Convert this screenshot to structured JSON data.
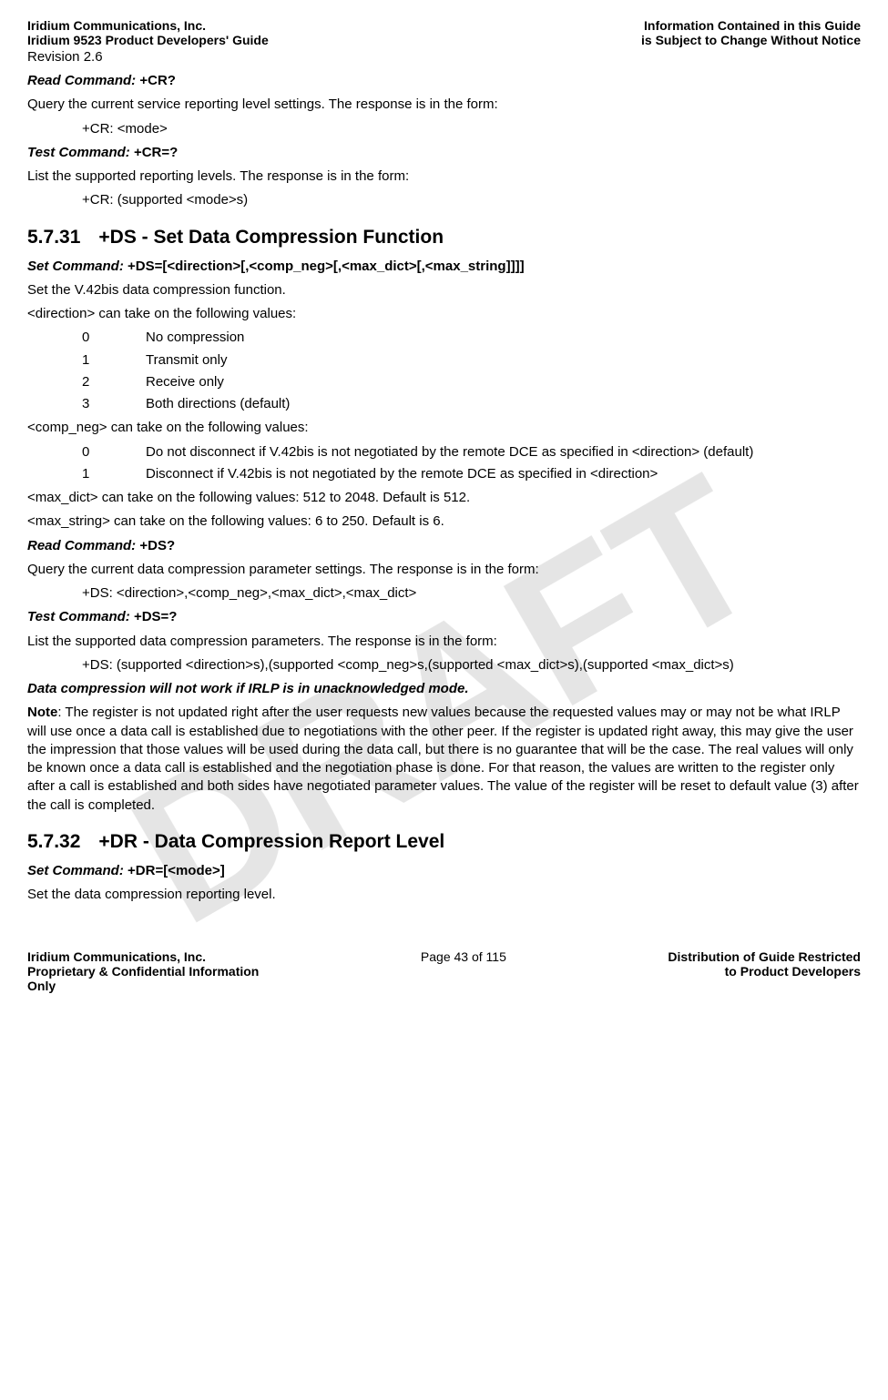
{
  "watermark": "DRAFT",
  "header": {
    "left_line1": "Iridium Communications, Inc.",
    "left_line2": "Iridium 9523 Product Developers' Guide",
    "right_line1": "Information Contained in this Guide",
    "right_line2": "is Subject to Change Without Notice",
    "revision": "Revision 2.6"
  },
  "cr_section": {
    "read_label": "Read Command: ",
    "read_cmd": "+CR?",
    "read_desc": "Query the current service reporting level settings.  The response is in the form:",
    "read_resp": "+CR: <mode>",
    "test_label": "Test Command: ",
    "test_cmd": "+CR=?",
    "test_desc": "List the supported reporting levels.  The response is in the form:",
    "test_resp": "+CR: (supported <mode>s)"
  },
  "section_5731": {
    "num": "5.7.31",
    "title": "+DS - Set Data Compression Function",
    "set_label": "Set Command: ",
    "set_cmd": "+DS=[<direction>[,<comp_neg>[,<max_dict>[,<max_string]]]]",
    "set_desc": "Set the V.42bis data compression function.",
    "direction_intro": "<direction> can take on the following values:",
    "direction_vals": [
      {
        "k": "0",
        "v": "No compression"
      },
      {
        "k": "1",
        "v": "Transmit only"
      },
      {
        "k": "2",
        "v": "Receive only"
      },
      {
        "k": "3",
        "v": "Both directions (default)"
      }
    ],
    "compneg_intro": "<comp_neg> can take on the following values:",
    "compneg_vals": [
      {
        "k": "0",
        "v": "Do not disconnect if V.42bis is not negotiated by the remote DCE as specified in <direction> (default)"
      },
      {
        "k": "1",
        "v": "Disconnect if V.42bis is not negotiated by the remote DCE as specified in <direction>"
      }
    ],
    "maxdict": "<max_dict> can take on the following values: 512 to 2048. Default is 512.",
    "maxstring": "<max_string> can take on the following values: 6 to 250. Default is 6.",
    "read_label": "Read Command: ",
    "read_cmd": "+DS?",
    "read_desc": "Query the current data compression parameter settings.  The response is in the form:",
    "read_resp": "+DS: <direction>,<comp_neg>,<max_dict>,<max_dict>",
    "test_label": "Test Command: ",
    "test_cmd": "+DS=?",
    "test_desc": "List the supported data compression parameters.  The response is in the form:",
    "test_resp": "+DS: (supported <direction>s),(supported <comp_neg>s,(supported <max_dict>s),(supported <max_dict>s)",
    "warn": "Data compression will not work if IRLP is in unacknowledged mode.",
    "note_prefix": "Note",
    "note_body": ": The register is not updated right after the user requests new values because the requested values may or may not be what IRLP will use once a data call is established due to negotiations with the other peer. If the register is updated right away, this may give the user the impression that those values will be used during the data call, but there is no guarantee that will be the case. The real values will only be known once a data call is established and the negotiation phase is done. For that reason, the values are written to the register only after a call is established and both sides have negotiated parameter values. The value of the register will be reset to default value (3) after the call is completed."
  },
  "section_5732": {
    "num": "5.7.32",
    "title": "+DR - Data Compression Report Level",
    "set_label": "Set Command: ",
    "set_cmd": "+DR=[<mode>]",
    "set_desc": "Set the data compression reporting level."
  },
  "footer": {
    "left_line1": "Iridium Communications, Inc.",
    "left_line2": "Proprietary & Confidential Information",
    "left_line3": "Only",
    "middle": "Page 43 of 115",
    "right_line1": "Distribution of Guide Restricted",
    "right_line2": "to Product Developers"
  }
}
